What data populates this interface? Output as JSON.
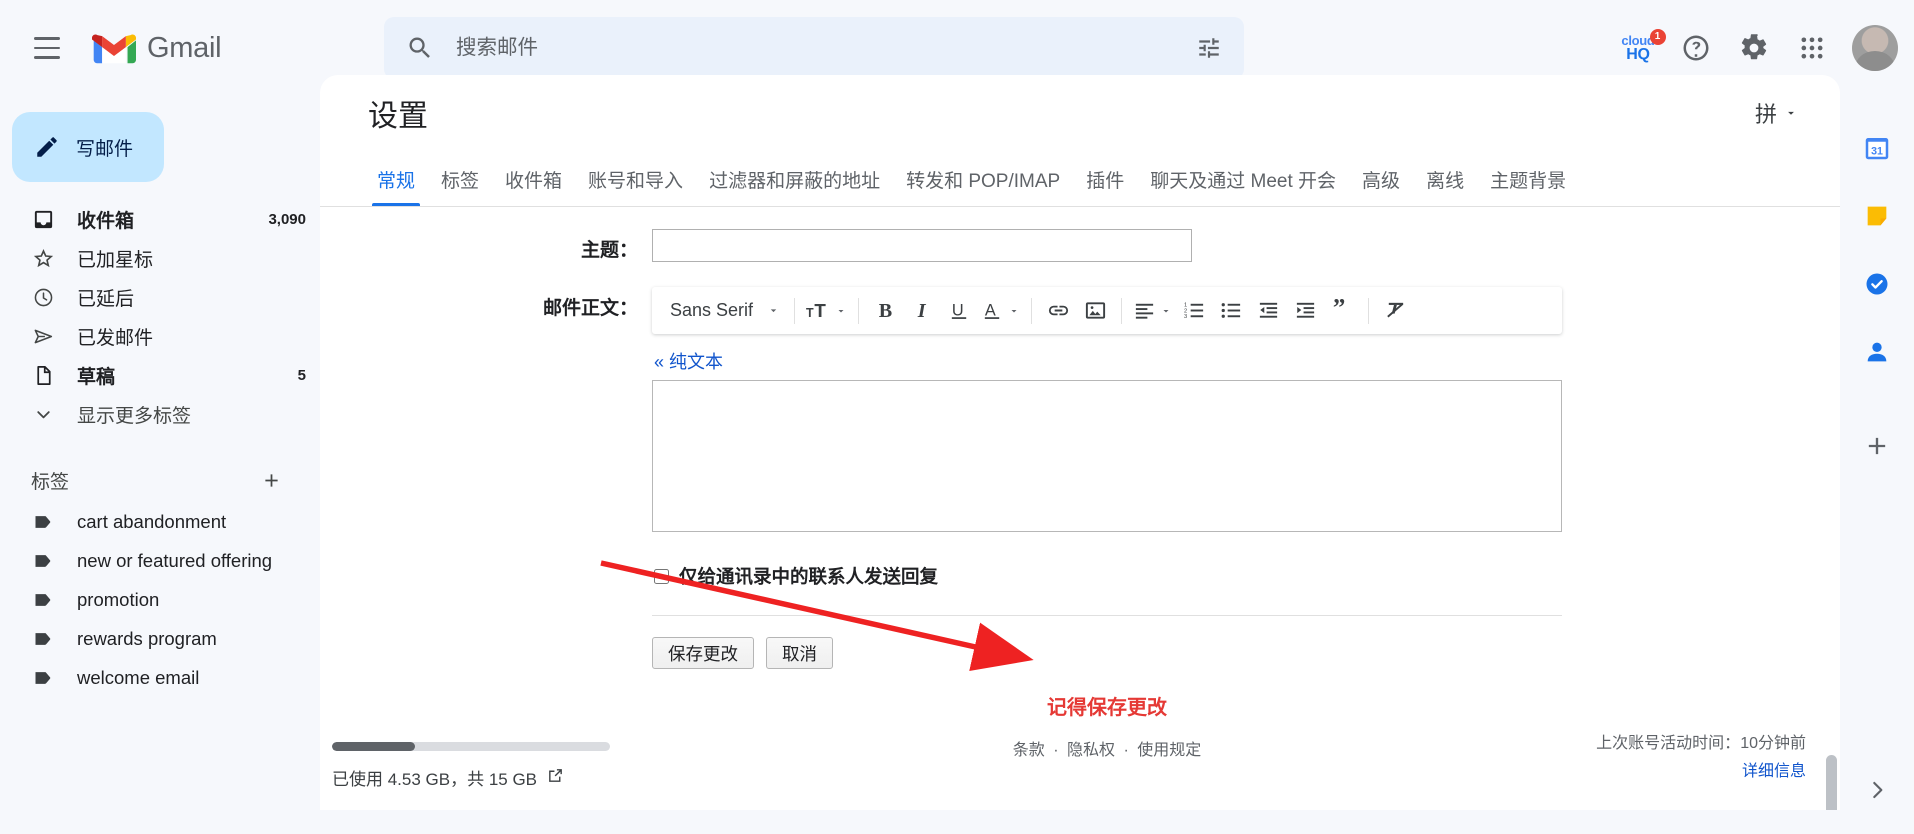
{
  "app": {
    "brand": "Gmail",
    "menu_icon": "hamburger-icon"
  },
  "search": {
    "placeholder": "搜索邮件",
    "value": "",
    "icon": "search-icon",
    "options_icon": "search-options-icon"
  },
  "header_actions": {
    "cloudhq_line1": "cloud",
    "cloudhq_line2": "HQ",
    "cloudhq_badge": "1",
    "help_icon": "help-icon",
    "settings_icon": "gear-icon",
    "apps_icon": "apps-grid-icon",
    "avatar": "user-avatar"
  },
  "sidebar": {
    "compose_label": "写邮件",
    "nav_items": [
      {
        "label": "收件箱",
        "count": "3,090",
        "icon": "inbox-icon",
        "bold": true
      },
      {
        "label": "已加星标",
        "count": "",
        "icon": "star-icon",
        "bold": false
      },
      {
        "label": "已延后",
        "count": "",
        "icon": "clock-icon",
        "bold": false
      },
      {
        "label": "已发邮件",
        "count": "",
        "icon": "send-icon",
        "bold": false
      },
      {
        "label": "草稿",
        "count": "5",
        "icon": "draft-icon",
        "bold": true
      },
      {
        "label": "显示更多标签",
        "count": "",
        "icon": "chevron-down-icon",
        "bold": false
      }
    ],
    "labels_title": "标签",
    "add_label_icon": "plus-icon",
    "labels": [
      {
        "name": "cart abandonment"
      },
      {
        "name": "new or featured offering"
      },
      {
        "name": "promotion"
      },
      {
        "name": "rewards program"
      },
      {
        "name": "welcome email"
      }
    ]
  },
  "settings": {
    "title": "设置",
    "lang_label": "拼",
    "lang_caret": "chevron-down-icon",
    "tabs": [
      {
        "label": "常规",
        "active": true
      },
      {
        "label": "标签",
        "active": false
      },
      {
        "label": "收件箱",
        "active": false
      },
      {
        "label": "账号和导入",
        "active": false
      },
      {
        "label": "过滤器和屏蔽的地址",
        "active": false
      },
      {
        "label": "转发和 POP/IMAP",
        "active": false
      },
      {
        "label": "插件",
        "active": false
      },
      {
        "label": "聊天及通过 Meet 开会",
        "active": false
      },
      {
        "label": "高级",
        "active": false
      },
      {
        "label": "离线",
        "active": false
      },
      {
        "label": "主题背景",
        "active": false
      }
    ]
  },
  "form": {
    "subject_label": "主题：",
    "subject_value": "",
    "body_label": "邮件正文：",
    "body_value": "",
    "plain_text_link": "« 纯文本",
    "contacts_only_label": "仅给通讯录中的联系人发送回复",
    "contacts_only_checked": false,
    "save_label": "保存更改",
    "cancel_label": "取消"
  },
  "toolbar": {
    "font_name": "Sans Serif",
    "buttons": [
      {
        "icon": "font-family-select",
        "label": "Sans Serif"
      },
      {
        "icon": "font-size-icon",
        "label": ""
      },
      {
        "icon": "bold-icon",
        "label": "B"
      },
      {
        "icon": "italic-icon",
        "label": "I"
      },
      {
        "icon": "underline-icon",
        "label": "U"
      },
      {
        "icon": "text-color-icon",
        "label": "A"
      },
      {
        "icon": "link-icon",
        "label": ""
      },
      {
        "icon": "insert-image-icon",
        "label": ""
      },
      {
        "icon": "align-icon",
        "label": ""
      },
      {
        "icon": "numbered-list-icon",
        "label": ""
      },
      {
        "icon": "bulleted-list-icon",
        "label": ""
      },
      {
        "icon": "indent-less-icon",
        "label": ""
      },
      {
        "icon": "indent-more-icon",
        "label": ""
      },
      {
        "icon": "quote-icon",
        "label": ""
      },
      {
        "icon": "remove-formatting-icon",
        "label": ""
      }
    ]
  },
  "annotation": {
    "remind_text": "记得保存更改",
    "arrow_color": "#ee2222"
  },
  "footer": {
    "terms": "条款",
    "privacy": "隐私权",
    "policies": "使用规定",
    "separator": "·",
    "storage_text": "已使用 4.53 GB，共 15 GB",
    "storage_percent": 30,
    "storage_ext_icon": "open-in-new-icon",
    "activity_label": "上次账号活动时间：",
    "activity_value": "10分钟前",
    "activity_details": "详细信息"
  },
  "rail": {
    "items": [
      {
        "icon": "calendar-icon",
        "badge": "31"
      },
      {
        "icon": "keep-icon",
        "badge": ""
      },
      {
        "icon": "tasks-icon",
        "badge": ""
      },
      {
        "icon": "contacts-icon",
        "badge": ""
      }
    ],
    "add_icon": "plus-icon",
    "expand_icon": "chevron-right-icon"
  }
}
